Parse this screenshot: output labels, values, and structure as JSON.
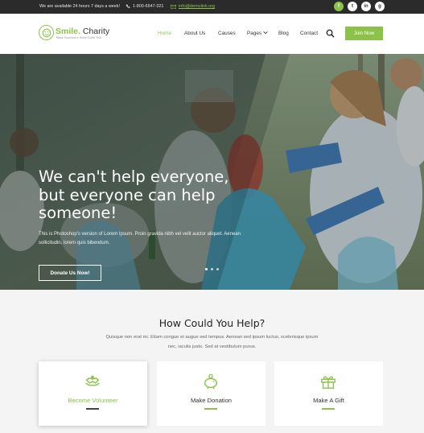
{
  "topbar": {
    "availability": "We are available 24 hours 7 days a week!",
    "phone": "1-800-6547-321",
    "email": "info@demolink.org",
    "socials": [
      "f",
      "t",
      "in",
      "g"
    ]
  },
  "header": {
    "logo_title_a": "Smile.",
    "logo_title_b": " Charity",
    "logo_tagline": "Make Someone's Smile Come True",
    "nav": [
      "Home",
      "About Us",
      "Causes",
      "Pages",
      "Blog",
      "Contact"
    ],
    "join_label": "Join Now"
  },
  "hero": {
    "heading": "We can't help everyone, but everyone can help someone!",
    "paragraph": "This is Photoshop's version  of Lorem Ipsum. Proin gravida nibh vel velit auctor aliquet. Aenean sollicitudin, lorem quis bibendum.",
    "donate_label": "Donate Us Now!"
  },
  "help": {
    "title": "How Could You Help?",
    "text": "Quisque non erat mi. Etiam congue et augue sed tempus. Aenean sed ipsum luctus, scelerisque ipsum nec, iaculis justo. Sed at vestibulum purus.",
    "cards": [
      {
        "label": "Become Volunteer",
        "icon": "volunteer-hands-icon"
      },
      {
        "label": "Make Donation",
        "icon": "piggy-bank-icon"
      },
      {
        "label": "Make A Gift",
        "icon": "gift-icon"
      }
    ]
  },
  "colors": {
    "accent": "#8bc34a",
    "topbar": "#2b2b2b"
  }
}
